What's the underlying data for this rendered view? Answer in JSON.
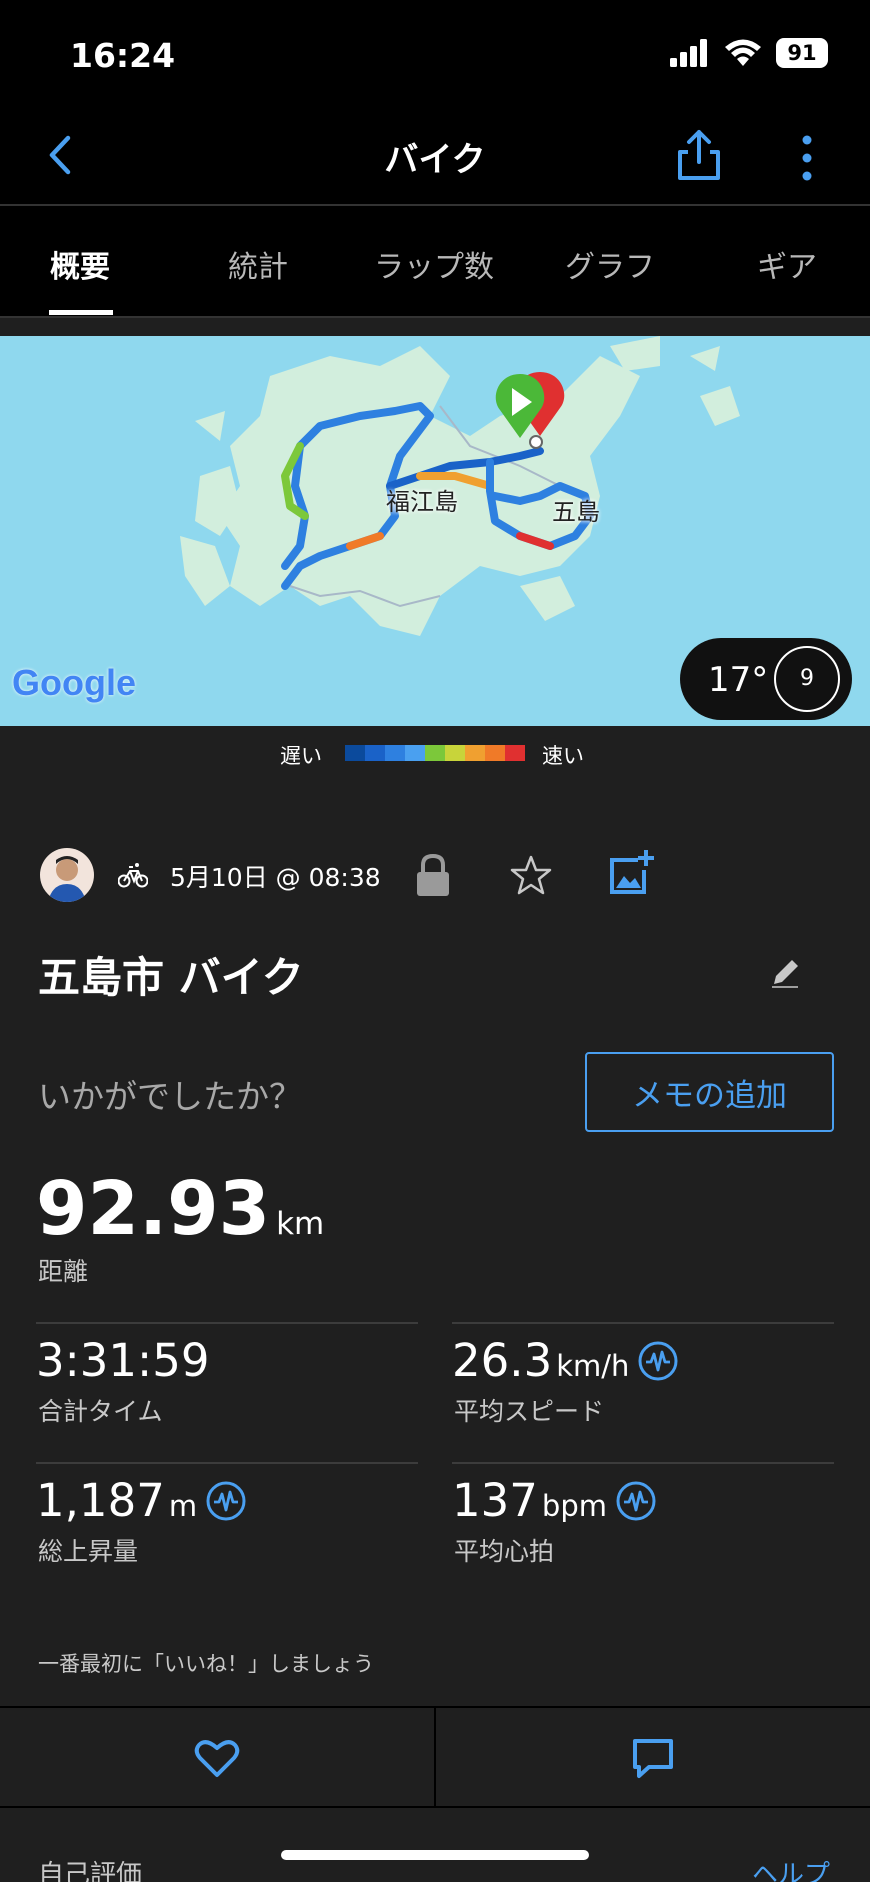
{
  "status_bar": {
    "time": "16:24",
    "battery": "91"
  },
  "nav": {
    "title": "バイク"
  },
  "tabs": [
    {
      "label": "概要"
    },
    {
      "label": "統計"
    },
    {
      "label": "ラップ数"
    },
    {
      "label": "グラフ"
    },
    {
      "label": "ギア"
    }
  ],
  "map": {
    "labels": {
      "island": "福江島",
      "town": "五島"
    },
    "attribution": "Google",
    "weather": {
      "temp": "17°",
      "wind": "9"
    }
  },
  "speed_legend": {
    "slow": "遅い",
    "fast": "速い",
    "colors": [
      "#0b4a9c",
      "#1a62c8",
      "#2e80e0",
      "#4aa0f0",
      "#7cc83a",
      "#c8d43a",
      "#f0a030",
      "#f07a28",
      "#e03030"
    ]
  },
  "activity": {
    "date": "5月10日 @ 08:38",
    "title": "五島市 バイク",
    "prompt": "いかがでしたか？",
    "memo_button": "メモの追加",
    "distance": {
      "value": "92.93",
      "unit": "km",
      "label": "距離"
    },
    "stats": [
      {
        "value": "3:31:59",
        "unit": "",
        "label": "合計タイム"
      },
      {
        "value": "26.3",
        "unit": "km/h",
        "label": "平均スピード"
      },
      {
        "value": "1,187",
        "unit": "m",
        "label": "総上昇量"
      },
      {
        "value": "137",
        "unit": "bpm",
        "label": "平均心拍"
      }
    ],
    "like_prompt": "一番最初に「いいね！」しましょう"
  },
  "footer": {
    "rating": "自己評価",
    "help": "ヘルプ"
  },
  "colors": {
    "accent": "#4a9ff0",
    "background": "#1f1f1f"
  }
}
